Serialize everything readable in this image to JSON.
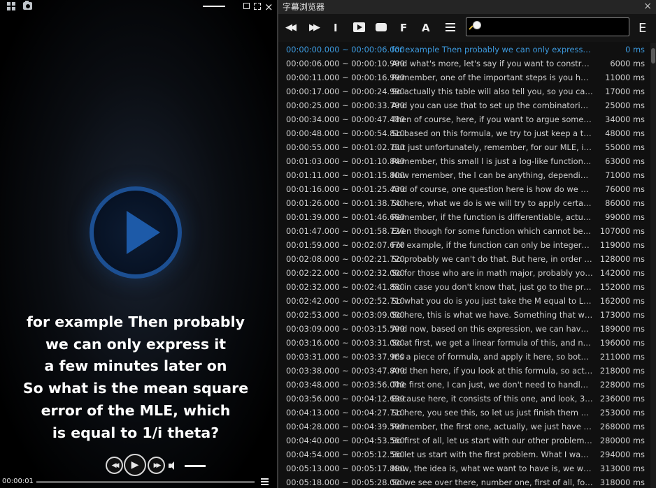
{
  "player": {
    "subtitle_lines": [
      "for example Then probably",
      "we can only express it",
      "a few minutes later on",
      "So what is the mean square",
      "error of the MLE,  which",
      "is equal to 1/i theta?"
    ],
    "current_time": "00:00:01",
    "progress": 0.0
  },
  "browser": {
    "title": "字幕浏览器",
    "toolbar": {
      "f_label": "F",
      "a_label": "A",
      "i_label": "I",
      "e_label": "E",
      "search_value": "",
      "search_placeholder": ""
    },
    "rows": [
      {
        "time": "00:00:00.000 ~ 00:00:06.000",
        "text": "for example Then probably we can only express it a few minutes later on",
        "delay": "0 ms",
        "active": true
      },
      {
        "time": "00:00:06.000 ~ 00:00:10.990",
        "text": "And what's more, let's say if you want to construct a confidence interval",
        "delay": "6000 ms"
      },
      {
        "time": "00:00:11.000 ~ 00:00:16.990",
        "text": "Remember, one of the important steps is you have to find the distribution",
        "delay": "11000 ms"
      },
      {
        "time": "00:00:17.000 ~ 00:00:24.990",
        "text": "So actually this table will also tell you,  so you can just look it up",
        "delay": "17000 ms"
      },
      {
        "time": "00:00:25.000 ~ 00:00:33.790",
        "text": "And you can use that to set up the combinatorial interval for this one",
        "delay": "25000 ms"
      },
      {
        "time": "00:00:34.000 ~ 00:00:47.480",
        "text": "Then of course, here, if you want to argue some kind of property",
        "delay": "34000 ms"
      },
      {
        "time": "00:00:48.000 ~ 00:00:54.810",
        "text": "So based on this formula, we try to just keep a theoretical result",
        "delay": "48000 ms"
      },
      {
        "time": "00:00:55.000 ~ 00:01:02.730",
        "text": "But just unfortunately, remember, for our MLE, in most of the cases",
        "delay": "55000 ms"
      },
      {
        "time": "00:01:03.000 ~ 00:01:10.840",
        "text": "Remember, this small l is just a log-like function.  So it can be anything",
        "delay": "63000 ms"
      },
      {
        "time": "00:01:11.000 ~ 00:01:15.800",
        "text": "Now remember, the l can be anything, depending on the distribution",
        "delay": "71000 ms"
      },
      {
        "time": "00:01:16.000 ~ 00:01:25.430",
        "text": "And of course,  one question here is how do we obtain the solution",
        "delay": "76000 ms"
      },
      {
        "time": "00:01:26.000 ~ 00:01:38.740",
        "text": "So here, what we do is we will try to apply certain formula",
        "delay": "86000 ms"
      },
      {
        "time": "00:01:39.000 ~ 00:01:46.680",
        "text": "Remember, if the function is differentiable, actually it is fine",
        "delay": "99000 ms"
      },
      {
        "time": "00:01:47.000 ~ 00:01:58.720",
        "text": "Even though for some function which cannot be integrated directly",
        "delay": "107000 ms"
      },
      {
        "time": "00:01:59.000 ~ 00:02:07.670",
        "text": "For example, if the function can only be integerable numerically",
        "delay": "119000 ms"
      },
      {
        "time": "00:02:08.000 ~ 00:02:21.720",
        "text": "So probably we can't do that.  But here, in order to solve this",
        "delay": "128000 ms"
      },
      {
        "time": "00:02:22.000 ~ 00:02:32.000",
        "text": "So for those who are in math major,  probably you know this already",
        "delay": "142000 ms"
      },
      {
        "time": "00:02:32.000 ~ 00:02:41.880",
        "text": "So in case you don't know that, just go to the proof of the theorem",
        "delay": "152000 ms"
      },
      {
        "time": "00:02:42.000 ~ 00:02:52.710",
        "text": "So what you do is you just take the M equal to L times something",
        "delay": "162000 ms"
      },
      {
        "time": "00:02:53.000 ~ 00:03:09.000",
        "text": "So here, this is what we have.  Something that we discuss here",
        "delay": "173000 ms"
      },
      {
        "time": "00:03:09.000 ~ 00:03:15.590",
        "text": "And now, based on this expression, we can have something else",
        "delay": "189000 ms"
      },
      {
        "time": "00:03:16.000 ~ 00:03:31.000",
        "text": "So at first, we get a linear formula of this, and now, once again",
        "delay": "196000 ms"
      },
      {
        "time": "00:03:31.000 ~ 00:03:37.960",
        "text": "It's a piece of formula, and apply it here, so both of these terms",
        "delay": "211000 ms"
      },
      {
        "time": "00:03:38.000 ~ 00:03:47.800",
        "text": "And then here, if you look at this formula, so actually it is simple",
        "delay": "218000 ms"
      },
      {
        "time": "00:03:48.000 ~ 00:03:56.000",
        "text": "The first one, I can just, we don't need to handle too much about it",
        "delay": "228000 ms"
      },
      {
        "time": "00:03:56.000 ~ 00:04:12.630",
        "text": "Because here, it consists of this one, and look, 3, so 3 parts",
        "delay": "236000 ms"
      },
      {
        "time": "00:04:13.000 ~ 00:04:27.710",
        "text": "So here, you see this, so let us just finish them one by one",
        "delay": "253000 ms"
      },
      {
        "time": "00:04:28.000 ~ 00:04:39.590",
        "text": "Remember, the first one, actually, we just have to let it go",
        "delay": "268000 ms"
      },
      {
        "time": "00:04:40.000 ~ 00:04:53.560",
        "text": "So first of all, let us start with our other problems.  That is the one",
        "delay": "280000 ms"
      },
      {
        "time": "00:04:54.000 ~ 00:05:12.560",
        "text": "So let us start with the first problem.  What I want to show you",
        "delay": "294000 ms"
      },
      {
        "time": "00:05:13.000 ~ 00:05:17.890",
        "text": "Now, the idea is, what we want to have is, we want to show that",
        "delay": "313000 ms"
      },
      {
        "time": "00:05:18.000 ~ 00:05:28.000",
        "text": "So we see over there, number one, first of all, for this one",
        "delay": "318000 ms"
      }
    ]
  },
  "colors": {
    "active_row": "#3d9be0",
    "play_ring": "#1c4f92"
  }
}
